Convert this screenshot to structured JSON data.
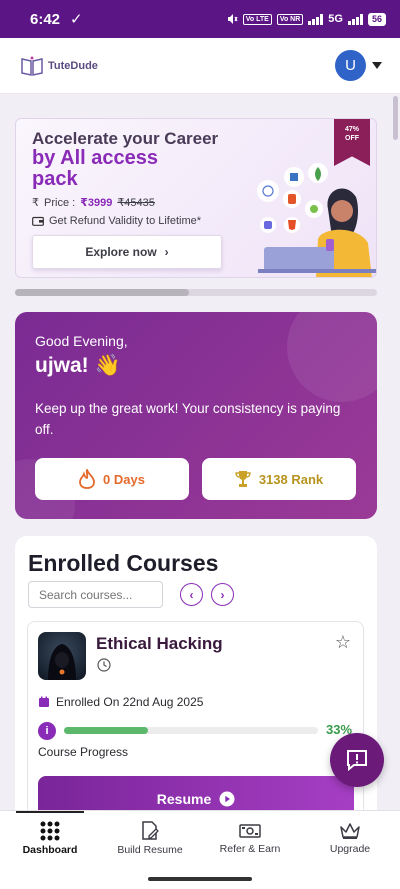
{
  "status_bar": {
    "time": "6:42",
    "check_icon": "check-icon",
    "sim1": "Vo LTE",
    "sim2": "Vo NR",
    "network": "5G",
    "battery": "56"
  },
  "header": {
    "logo_text": "TuteDude",
    "avatar_initial": "U"
  },
  "promo": {
    "line1": "Accelerate your Career",
    "line2": "by All access pack",
    "price_label": "Price :",
    "price_now": "₹3999",
    "price_old": "₹45435",
    "refund_text": "Get Refund Validity to Lifetime*",
    "explore_label": "Explore now",
    "badge_pct": "47%",
    "badge_off": "OFF"
  },
  "greeting": {
    "salutation": "Good Evening,",
    "name": "ujwa! 👋",
    "message": "Keep up the great work! Your consistency is paying off.",
    "days": "0 Days",
    "rank": "3138 Rank"
  },
  "enrolled": {
    "title": "Enrolled Courses",
    "search_placeholder": "Search courses...",
    "prev": "‹",
    "next": "›",
    "course": {
      "title": "Ethical Hacking",
      "enrolled_on": "Enrolled On 22nd Aug 2025",
      "info": "i",
      "progress_pct": "33%",
      "progress_value": 0.33,
      "progress_label": "Course Progress",
      "resume_label": "Resume"
    }
  },
  "bottom_nav": {
    "tabs": [
      {
        "label": "Dashboard",
        "icon": "grid-icon"
      },
      {
        "label": "Build Resume",
        "icon": "resume-icon"
      },
      {
        "label": "Refer & Earn",
        "icon": "money-icon"
      },
      {
        "label": "Upgrade",
        "icon": "crown-icon"
      }
    ]
  },
  "colors": {
    "brand_purple": "#5b1585",
    "accent": "#8a2bb8",
    "progress_green": "#5cb86a"
  }
}
